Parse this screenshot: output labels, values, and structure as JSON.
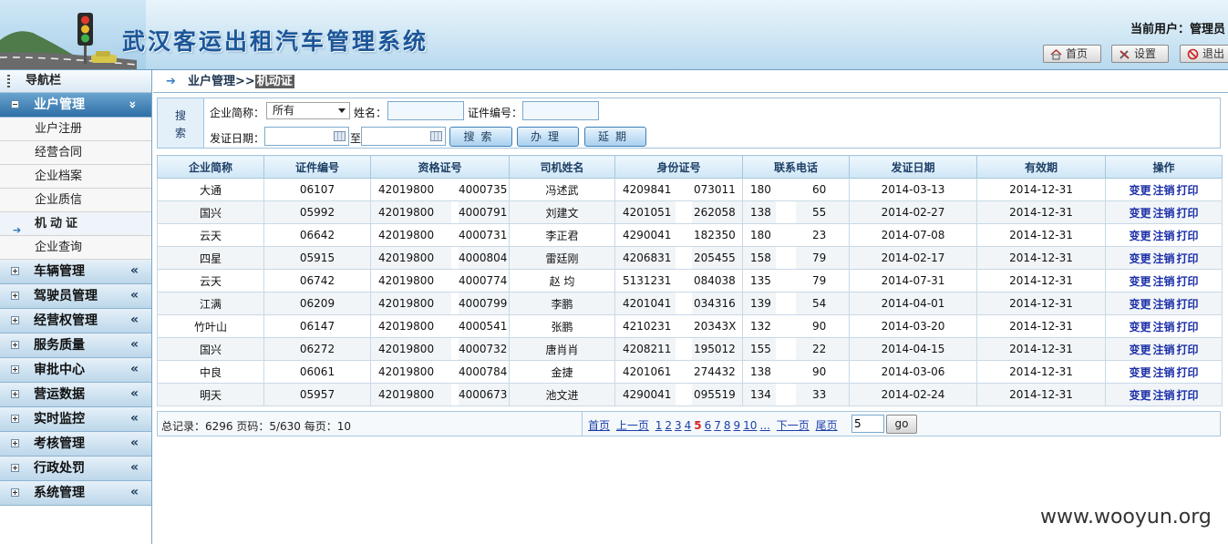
{
  "header": {
    "title": "武汉客运出租汽车管理系统",
    "current_user": "当前用户：管理员",
    "buttons": {
      "home": "首页",
      "settings": "设置",
      "logout": "退出"
    }
  },
  "sidebar": {
    "nav_title": "导航栏",
    "active_group": "业户管理",
    "sub_items": [
      "业户注册",
      "经营合同",
      "企业档案",
      "企业质信",
      "机动证",
      "企业查询"
    ],
    "groups": [
      "车辆管理",
      "驾驶员管理",
      "经营权管理",
      "服务质量",
      "审批中心",
      "营运数据",
      "实时监控",
      "考核管理",
      "行政处罚",
      "系统管理"
    ]
  },
  "breadcrumb": {
    "parent": "业户管理>>",
    "current": "机动证"
  },
  "search": {
    "tag_line1": "搜",
    "tag_line2": "索",
    "company_label": "企业简称：",
    "company_value": "所有",
    "name_label": "姓名：",
    "cert_label": "证件编号：",
    "date_label": "发证日期：",
    "to_label": "至",
    "btn_search": "搜索",
    "btn_handle": "办理",
    "btn_extend": "延期"
  },
  "table": {
    "headers": [
      "企业简称",
      "证件编号",
      "资格证号",
      "司机姓名",
      "身份证号",
      "联系电话",
      "发证日期",
      "有效期",
      "操作"
    ],
    "ops": [
      "变更",
      "注销",
      "打印"
    ],
    "rows": [
      {
        "company": "大通",
        "cert": "06107",
        "qual_a": "42019800",
        "qual_b": "4000735",
        "driver": "冯述武",
        "id_a": "4209841",
        "id_b": "073011",
        "phone_a": "180",
        "phone_b": "60",
        "issue": "2014-03-13",
        "valid": "2014-12-31"
      },
      {
        "company": "国兴",
        "cert": "05992",
        "qual_a": "42019800",
        "qual_b": "4000791",
        "driver": "刘建文",
        "id_a": "4201051",
        "id_b": "262058",
        "phone_a": "138",
        "phone_b": "55",
        "issue": "2014-02-27",
        "valid": "2014-12-31"
      },
      {
        "company": "云天",
        "cert": "06642",
        "qual_a": "42019800",
        "qual_b": "4000731",
        "driver": "李正君",
        "id_a": "4290041",
        "id_b": "182350",
        "phone_a": "180",
        "phone_b": "23",
        "issue": "2014-07-08",
        "valid": "2014-12-31"
      },
      {
        "company": "四星",
        "cert": "05915",
        "qual_a": "42019800",
        "qual_b": "4000804",
        "driver": "雷廷刚",
        "id_a": "4206831",
        "id_b": "205455",
        "phone_a": "158",
        "phone_b": "79",
        "issue": "2014-02-17",
        "valid": "2014-12-31"
      },
      {
        "company": "云天",
        "cert": "06742",
        "qual_a": "42019800",
        "qual_b": "4000774",
        "driver": "赵 均",
        "id_a": "5131231",
        "id_b": "084038",
        "phone_a": "135",
        "phone_b": "79",
        "issue": "2014-07-31",
        "valid": "2014-12-31"
      },
      {
        "company": "江满",
        "cert": "06209",
        "qual_a": "42019800",
        "qual_b": "4000799",
        "driver": "李鹏",
        "id_a": "4201041",
        "id_b": "034316",
        "phone_a": "139",
        "phone_b": "54",
        "issue": "2014-04-01",
        "valid": "2014-12-31"
      },
      {
        "company": "竹叶山",
        "cert": "06147",
        "qual_a": "42019800",
        "qual_b": "4000541",
        "driver": "张鹏",
        "id_a": "4210231",
        "id_b": "20343X",
        "phone_a": "132",
        "phone_b": "90",
        "issue": "2014-03-20",
        "valid": "2014-12-31"
      },
      {
        "company": "国兴",
        "cert": "06272",
        "qual_a": "42019800",
        "qual_b": "4000732",
        "driver": "唐肖肖",
        "id_a": "4208211",
        "id_b": "195012",
        "phone_a": "155",
        "phone_b": "22",
        "issue": "2014-04-15",
        "valid": "2014-12-31"
      },
      {
        "company": "中良",
        "cert": "06061",
        "qual_a": "42019800",
        "qual_b": "4000784",
        "driver": "金捷",
        "id_a": "4201061",
        "id_b": "274432",
        "phone_a": "138",
        "phone_b": "90",
        "issue": "2014-03-06",
        "valid": "2014-12-31"
      },
      {
        "company": "明天",
        "cert": "05957",
        "qual_a": "42019800",
        "qual_b": "4000673",
        "driver": "池文进",
        "id_a": "4290041",
        "id_b": "095519",
        "phone_a": "134",
        "phone_b": "33",
        "issue": "2014-02-24",
        "valid": "2014-12-31"
      }
    ]
  },
  "pager": {
    "summary": "总记录：6296 页码：5/630 每页：10",
    "first": "首页",
    "prev": "上一页",
    "pages_before": [
      "1",
      "2",
      "3",
      "4"
    ],
    "current": "5",
    "pages_after": [
      "6",
      "7",
      "8",
      "9",
      "10"
    ],
    "ellipsis": "...",
    "next": "下一页",
    "last": "尾页",
    "input_value": "5",
    "go": "go"
  },
  "watermark": "www.wooyun.org"
}
